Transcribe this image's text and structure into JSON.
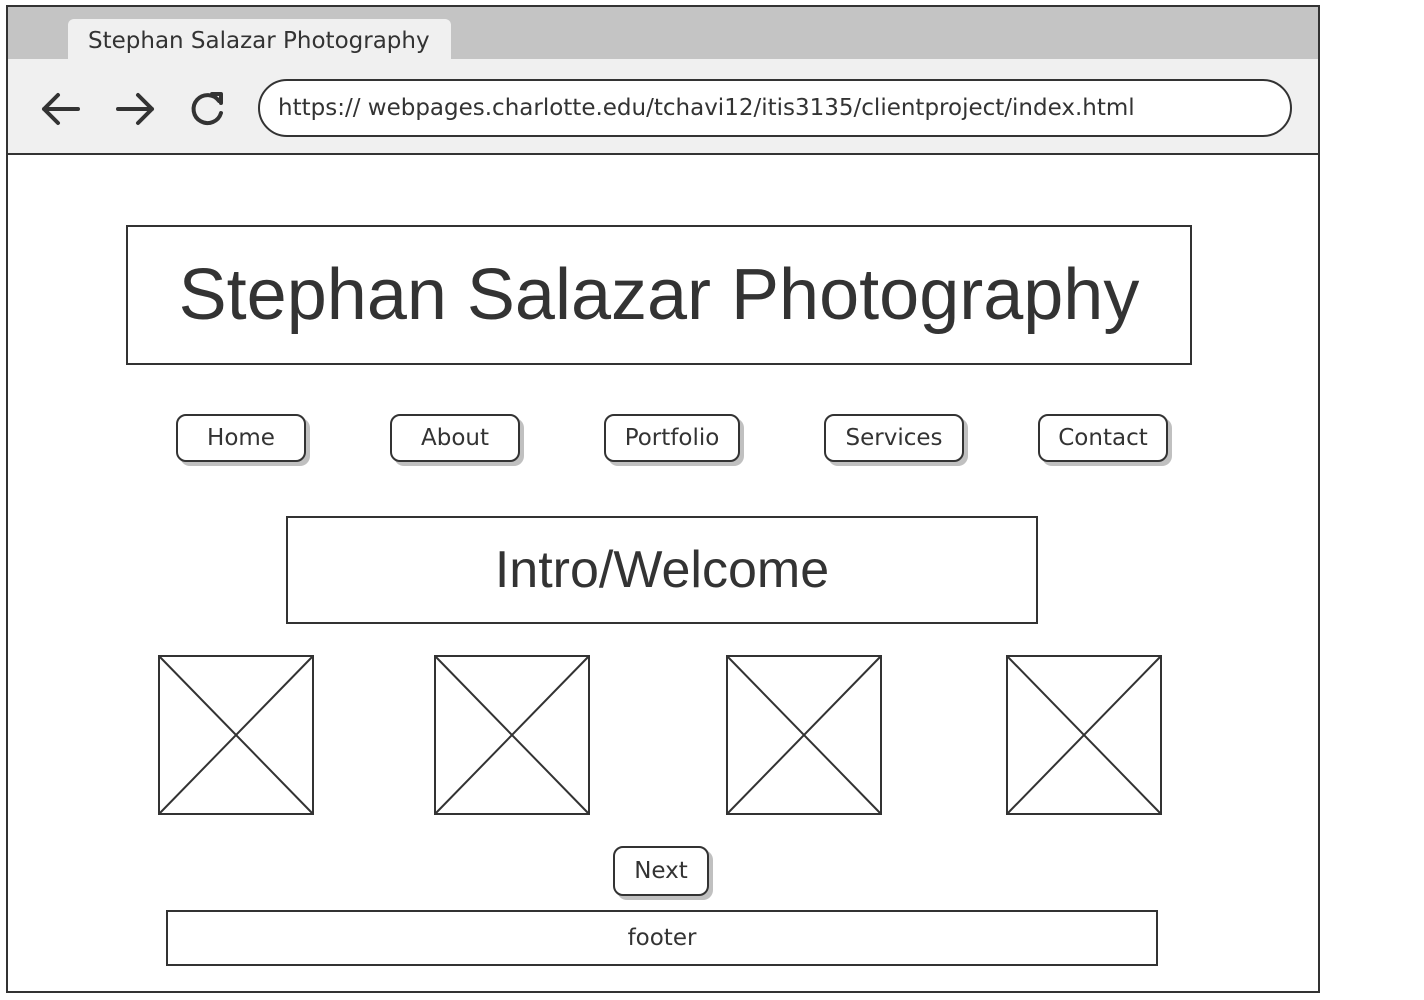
{
  "browser": {
    "tab_title": "Stephan Salazar Photography",
    "url": "https:// webpages.charlotte.edu/tchavi12/itis3135/clientproject/index.html",
    "icons": [
      "back-arrow-icon",
      "forward-arrow-icon",
      "reload-icon"
    ]
  },
  "page": {
    "site_title": "Stephan Salazar Photography",
    "nav": [
      "Home",
      "About",
      "Portfolio",
      "Services",
      "Contact"
    ],
    "intro": "Intro/Welcome",
    "gallery_image_count": 4,
    "next_label": "Next",
    "footer": "footer"
  },
  "colors": {
    "ink": "#333333",
    "tabstrip": "#c4c4c4",
    "toolbar": "#f0f0f0",
    "button_shadow": "#c0c0c0"
  }
}
